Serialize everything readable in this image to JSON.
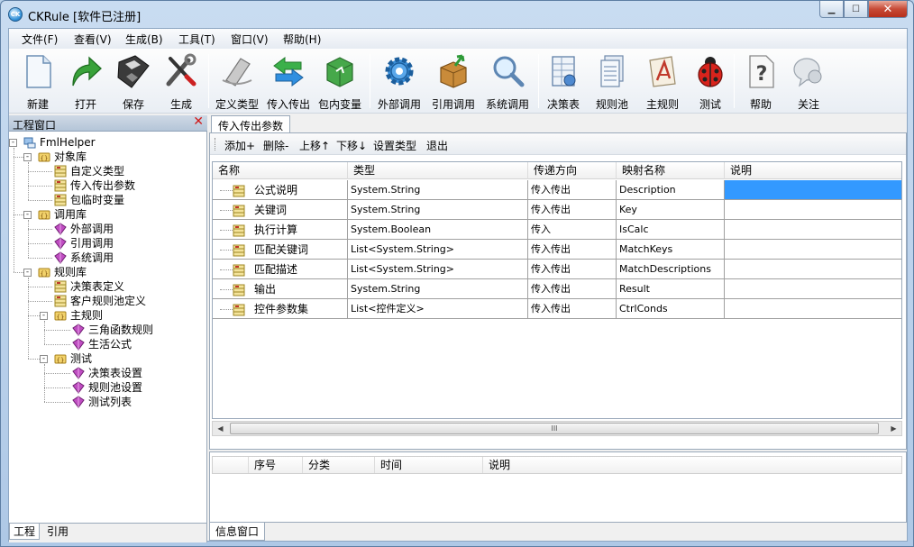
{
  "window": {
    "title": "CKRule [软件已注册]",
    "app_icon_text": "CK"
  },
  "menu": [
    {
      "label": "文件(F)"
    },
    {
      "label": "查看(V)"
    },
    {
      "label": "生成(B)"
    },
    {
      "label": "工具(T)"
    },
    {
      "label": "窗口(V)"
    },
    {
      "label": "帮助(H)"
    }
  ],
  "toolbar": [
    {
      "label": "新建",
      "icon": "new-document-icon"
    },
    {
      "label": "打开",
      "icon": "open-arrow-icon"
    },
    {
      "label": "保存",
      "icon": "floppy-disk-icon"
    },
    {
      "label": "生成",
      "icon": "tools-icon"
    },
    {
      "label": "定义类型",
      "icon": "define-type-icon"
    },
    {
      "label": "传入传出",
      "icon": "in-out-arrows-icon"
    },
    {
      "label": "包内变量",
      "icon": "package-variable-icon"
    },
    {
      "label": "外部调用",
      "icon": "gear-icon"
    },
    {
      "label": "引用调用",
      "icon": "reference-box-icon"
    },
    {
      "label": "系统调用",
      "icon": "magnifier-icon"
    },
    {
      "label": "决策表",
      "icon": "decision-table-icon"
    },
    {
      "label": "规则池",
      "icon": "rule-pool-icon"
    },
    {
      "label": "主规则",
      "icon": "main-rule-icon"
    },
    {
      "label": "测试",
      "icon": "ladybug-icon"
    },
    {
      "label": "帮助",
      "icon": "help-icon"
    },
    {
      "label": "关注",
      "icon": "follow-icon"
    }
  ],
  "left_pane": {
    "title": "工程窗口",
    "tree": [
      {
        "label": "FmlHelper",
        "level": 0,
        "icon": "project-icon",
        "expander": "-"
      },
      {
        "label": "对象库",
        "level": 1,
        "icon": "library-icon",
        "expander": "-"
      },
      {
        "label": "自定义类型",
        "level": 2,
        "icon": "class-icon"
      },
      {
        "label": "传入传出参数",
        "level": 2,
        "icon": "class-icon"
      },
      {
        "label": "包临时变量",
        "level": 2,
        "icon": "class-icon"
      },
      {
        "label": "调用库",
        "level": 1,
        "icon": "library-icon",
        "expander": "-"
      },
      {
        "label": "外部调用",
        "level": 2,
        "icon": "method-icon"
      },
      {
        "label": "引用调用",
        "level": 2,
        "icon": "method-icon"
      },
      {
        "label": "系统调用",
        "level": 2,
        "icon": "method-icon"
      },
      {
        "label": "规则库",
        "level": 1,
        "icon": "library-icon",
        "expander": "-"
      },
      {
        "label": "决策表定义",
        "level": 2,
        "icon": "class-icon"
      },
      {
        "label": "客户规则池定义",
        "level": 2,
        "icon": "class-icon"
      },
      {
        "label": "主规则",
        "level": 2,
        "icon": "library-icon",
        "expander": "-"
      },
      {
        "label": "三角函数规则",
        "level": 3,
        "icon": "method-icon"
      },
      {
        "label": "生活公式",
        "level": 3,
        "icon": "method-icon"
      },
      {
        "label": "测试",
        "level": 2,
        "icon": "library-icon",
        "expander": "-"
      },
      {
        "label": "决策表设置",
        "level": 3,
        "icon": "method-icon"
      },
      {
        "label": "规则池设置",
        "level": 3,
        "icon": "method-icon"
      },
      {
        "label": "测试列表",
        "level": 3,
        "icon": "method-icon"
      }
    ],
    "tabs": [
      {
        "label": "工程"
      },
      {
        "label": "引用"
      }
    ]
  },
  "doc": {
    "tab": "传入传出参数",
    "commands": [
      {
        "label": "添加+"
      },
      {
        "label": "删除-"
      },
      {
        "label": "上移↑"
      },
      {
        "label": "下移↓"
      },
      {
        "label": "设置类型"
      },
      {
        "label": "退出"
      }
    ],
    "columns": [
      "名称",
      "类型",
      "传递方向",
      "映射名称",
      "说明"
    ],
    "rows": [
      {
        "name": "公式说明",
        "type": "System.String",
        "direction": "传入传出",
        "mapping": "Description",
        "desc": ""
      },
      {
        "name": "关键词",
        "type": "System.String",
        "direction": "传入传出",
        "mapping": "Key",
        "desc": ""
      },
      {
        "name": "执行计算",
        "type": "System.Boolean",
        "direction": "传入",
        "mapping": "IsCalc",
        "desc": ""
      },
      {
        "name": "匹配关键词",
        "type": "List<System.String>",
        "direction": "传入传出",
        "mapping": "MatchKeys",
        "desc": ""
      },
      {
        "name": "匹配描述",
        "type": "List<System.String>",
        "direction": "传入传出",
        "mapping": "MatchDescriptions",
        "desc": ""
      },
      {
        "name": "输出",
        "type": "System.String",
        "direction": "传入传出",
        "mapping": "Result",
        "desc": ""
      },
      {
        "name": "控件参数集",
        "type": "List<控件定义>",
        "direction": "传入传出",
        "mapping": "CtrlConds",
        "desc": ""
      }
    ],
    "scroll_grip": "III"
  },
  "info": {
    "columns": [
      "序号",
      "分类",
      "时间",
      "说明"
    ],
    "tab": "信息窗口"
  },
  "colors": {
    "selection": "#3399ff",
    "close": "#c74a36"
  }
}
